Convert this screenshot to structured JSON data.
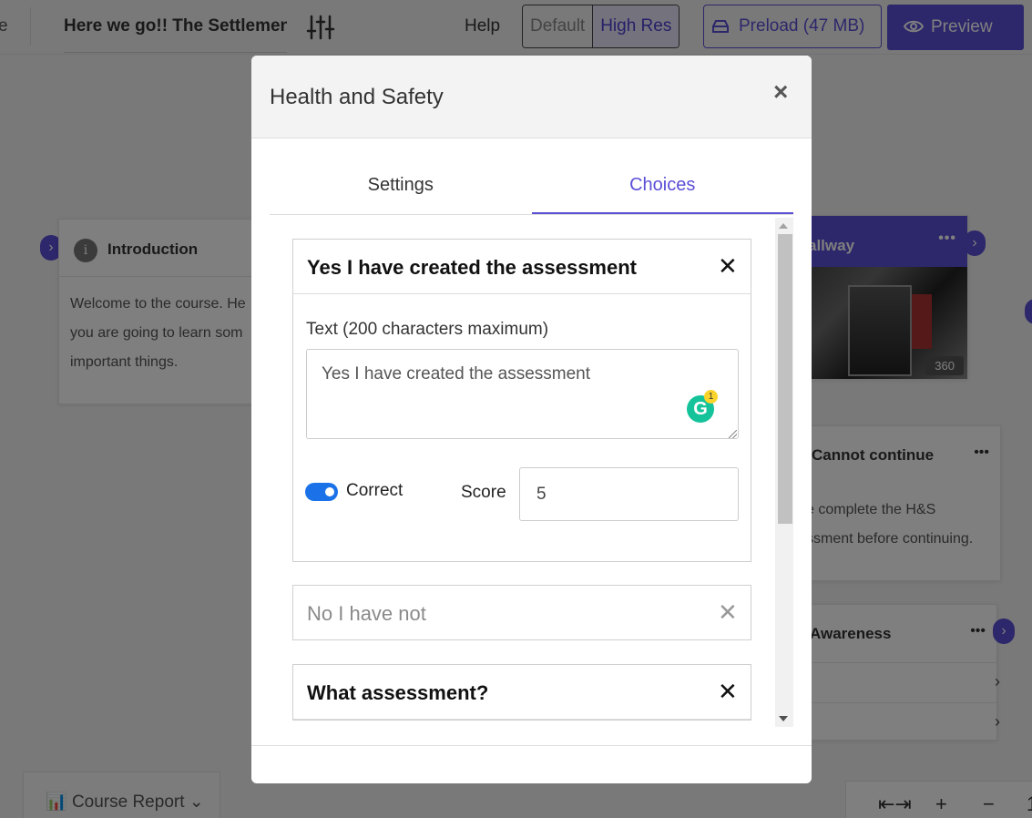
{
  "topbar": {
    "edge_text": "e",
    "course_title": "Here we go!!  The Settlement",
    "help": "Help",
    "res_default": "Default",
    "res_high": "High Res",
    "preload": "Preload (47 MB)",
    "preview": "Preview"
  },
  "background": {
    "intro": {
      "title": "Introduction",
      "body_lines": [
        "Welcome to the course. He",
        "you are going to learn som",
        "important things."
      ]
    },
    "hallway": {
      "title": "allway",
      "badge": "360"
    },
    "cannot": {
      "title": "Cannot continue",
      "body_lines": [
        "e complete the H&S",
        "ssment before continuing."
      ]
    },
    "awareness": {
      "title": "Awareness"
    },
    "course_report": "Course Report",
    "zoom": {
      "fit": "⇤⇥",
      "plus": "+",
      "minus": "−",
      "level": "1"
    }
  },
  "modal": {
    "title": "Health and Safety",
    "tabs": [
      {
        "label": "Settings",
        "active": false
      },
      {
        "label": "Choices",
        "active": true
      }
    ],
    "choices": [
      {
        "label": "Yes I have created the assessment",
        "expanded": true,
        "text_label": "Text (200 characters maximum)",
        "text_value": "Yes I have created the assessment",
        "correct_label": "Correct",
        "correct": true,
        "score_label": "Score",
        "score": "5"
      },
      {
        "label": "No I have not",
        "expanded": false
      },
      {
        "label": "What assessment?",
        "expanded": false
      }
    ],
    "grammarly_count": "1"
  },
  "colors": {
    "accent": "#5b4fd6",
    "toggle_on": "#1b72e8",
    "grammarly": "#15c39a"
  }
}
